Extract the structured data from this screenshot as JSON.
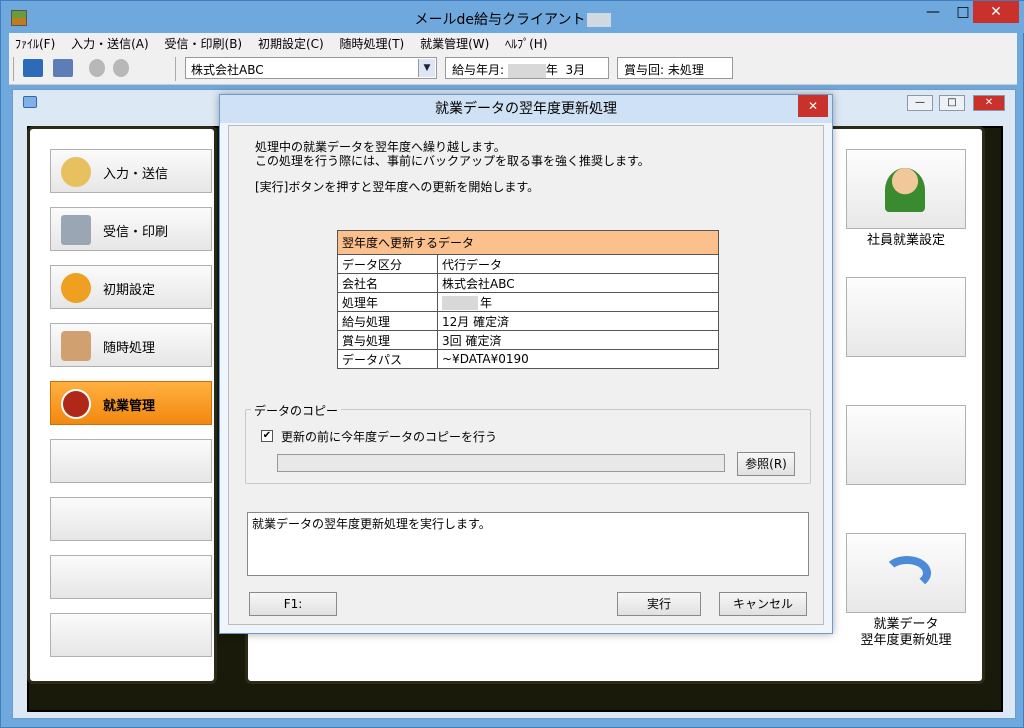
{
  "window": {
    "title": "メールde給与クライアント",
    "min_glyph": "—",
    "max_glyph": "□",
    "close_glyph": "✕"
  },
  "menu": [
    "ﾌｧｲﾙ(F)",
    "入力・送信(A)",
    "受信・印刷(B)",
    "初期設定(C)",
    "随時処理(T)",
    "就業管理(W)",
    "ﾍﾙﾌﾟ(H)"
  ],
  "toolbar": {
    "company": "株式会社ABC",
    "dropdown_glyph": "▼",
    "salary_label": "給与年月:",
    "salary_year_suffix": "年",
    "salary_month": "3月",
    "bonus_text": "賞与回: 未処理"
  },
  "mdi": {
    "min_glyph": "—",
    "max_glyph": "□",
    "close_glyph": "✕"
  },
  "nav": {
    "items": [
      {
        "label": "入力・送信",
        "icon": "input-send-icon"
      },
      {
        "label": "受信・印刷",
        "icon": "printer-icon"
      },
      {
        "label": "初期設定",
        "icon": "gear-icon"
      },
      {
        "label": "随時処理",
        "icon": "tools-icon"
      },
      {
        "label": "就業管理",
        "icon": "clock-icon",
        "active": true
      },
      {
        "label": ""
      },
      {
        "label": ""
      },
      {
        "label": ""
      },
      {
        "label": ""
      }
    ]
  },
  "tiles": {
    "employee": "社員就業設定",
    "rollover_line1": "就業データ",
    "rollover_line2": "翌年度更新処理"
  },
  "dialog": {
    "title": "就業データの翌年度更新処理",
    "close_glyph": "✕",
    "intro_line1": "処理中の就業データを翌年度へ繰り越します。",
    "intro_line2": "この処理を行う際には、事前にバックアップを取る事を強く推奨します。",
    "intro_line3": "[実行]ボタンを押すと翌年度への更新を開始します。",
    "table": {
      "header": "翌年度へ更新するデータ",
      "rows": [
        {
          "key": "データ区分",
          "value": "代行データ"
        },
        {
          "key": "会社名",
          "value": "株式会社ABC"
        },
        {
          "key": "処理年",
          "value": "年"
        },
        {
          "key": "給与処理",
          "value": "12月 確定済"
        },
        {
          "key": "賞与処理",
          "value": "3回 確定済"
        },
        {
          "key": "データパス",
          "value": "~¥DATA¥0190"
        }
      ]
    },
    "copy_group": "データのコピー",
    "copy_checked": true,
    "check_glyph": "✔",
    "copy_label": "更新の前に今年度データのコピーを行う",
    "browse_button": "参照(R)",
    "message": "就業データの翌年度更新処理を実行します。",
    "f1_button": "F1:",
    "run_button": "実行",
    "cancel_button": "キャンセル"
  },
  "colors": {
    "title_bar": "#6fa8dc",
    "active_nav": "#f28810",
    "table_header": "#fbc08c",
    "close_button": "#c9312a"
  }
}
